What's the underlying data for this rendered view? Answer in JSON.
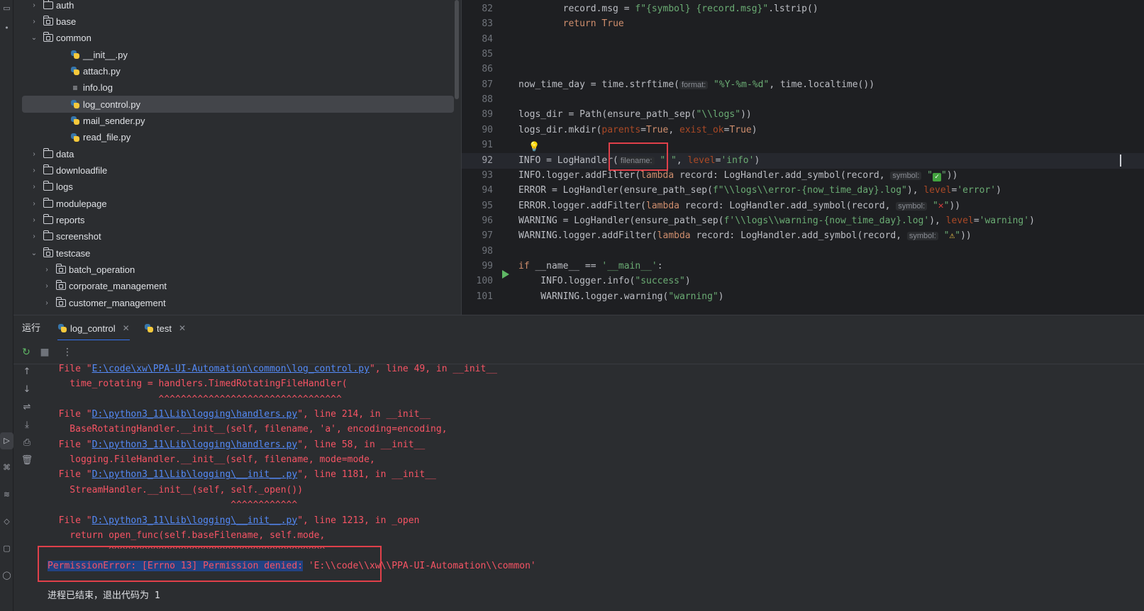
{
  "project_tree": {
    "items": [
      {
        "label": "auth",
        "type": "folder",
        "expanded": false
      },
      {
        "label": "base",
        "type": "package",
        "expanded": false
      },
      {
        "label": "common",
        "type": "package",
        "expanded": true
      },
      {
        "label": "__init__.py",
        "type": "python"
      },
      {
        "label": "attach.py",
        "type": "python"
      },
      {
        "label": "info.log",
        "type": "log"
      },
      {
        "label": "log_control.py",
        "type": "python",
        "selected": true
      },
      {
        "label": "mail_sender.py",
        "type": "python"
      },
      {
        "label": "read_file.py",
        "type": "python"
      },
      {
        "label": "data",
        "type": "folder",
        "expanded": false
      },
      {
        "label": "downloadfile",
        "type": "folder",
        "expanded": false
      },
      {
        "label": "logs",
        "type": "folder",
        "expanded": false
      },
      {
        "label": "modulepage",
        "type": "folder",
        "expanded": false
      },
      {
        "label": "reports",
        "type": "folder",
        "expanded": false
      },
      {
        "label": "screenshot",
        "type": "folder",
        "expanded": false
      },
      {
        "label": "testcase",
        "type": "package",
        "expanded": true
      },
      {
        "label": "batch_operation",
        "type": "package",
        "expanded": false
      },
      {
        "label": "corporate_management",
        "type": "package",
        "expanded": false
      },
      {
        "label": "customer_management",
        "type": "package",
        "expanded": false
      }
    ]
  },
  "editor": {
    "current_line": "92",
    "lines": [
      {
        "n": "82",
        "t": "        record.msg = f\"{symbol} {record.msg}\".lstrip()"
      },
      {
        "n": "83",
        "t": "        return True"
      },
      {
        "n": "84",
        "t": ""
      },
      {
        "n": "85",
        "t": ""
      },
      {
        "n": "86",
        "t": ""
      },
      {
        "n": "87",
        "a": "now_time_day = time.strftime(",
        "hint": "format:",
        "b": "\"%Y-%m-%d\", time.localtime())"
      },
      {
        "n": "88",
        "t": ""
      },
      {
        "n": "89",
        "t": "logs_dir = Path(ensure_path_sep(\"\\\\logs\"))"
      },
      {
        "n": "90",
        "t": "logs_dir.mkdir(parents=True, exist_ok=True)"
      },
      {
        "n": "91",
        "t": ""
      },
      {
        "n": "92",
        "a": "INFO = LogHandler(",
        "hint": "filename:",
        "b": "\" \", level='info')"
      },
      {
        "n": "93",
        "a": "INFO.logger.addFilter(lambda record: LogHandler.add_symbol(record, ",
        "hint": "symbol:",
        "b": "\"✅\"))"
      },
      {
        "n": "94",
        "t": "ERROR = LogHandler(ensure_path_sep(f\"\\\\logs\\\\error-{now_time_day}.log\"), level='error')"
      },
      {
        "n": "95",
        "a": "ERROR.logger.addFilter(lambda record: LogHandler.add_symbol(record, ",
        "hint": "symbol:",
        "b": "\"❌\"))"
      },
      {
        "n": "96",
        "t": "WARNING = LogHandler(ensure_path_sep(f'\\\\logs\\\\warning-{now_time_day}.log'), level='warning')"
      },
      {
        "n": "97",
        "a": "WARNING.logger.addFilter(lambda record: LogHandler.add_symbol(record, ",
        "hint": "symbol:",
        "b": "\"⚠\"))"
      },
      {
        "n": "98",
        "t": ""
      },
      {
        "n": "99",
        "t": "if __name__ == '__main__':"
      },
      {
        "n": "100",
        "t": "    INFO.logger.info(\"success\")"
      },
      {
        "n": "101",
        "t": "    WARNING.logger.warning(\"warning\")"
      }
    ]
  },
  "run_panel": {
    "title": "运行",
    "tabs": [
      {
        "label": "log_control",
        "active": true
      },
      {
        "label": "test",
        "active": false
      }
    ],
    "console": [
      {
        "pre": "  File \"",
        "link": "E:\\code\\xw\\PPA-UI-Automation\\common\\log_control.py",
        "post": "\", line 49, in __init__"
      },
      {
        "text": "    time_rotating = handlers.TimedRotatingFileHandler("
      },
      {
        "text": "                    ^^^^^^^^^^^^^^^^^^^^^^^^^^^^^^^^^"
      },
      {
        "pre": "  File \"",
        "link": "D:\\python3_11\\Lib\\logging\\handlers.py",
        "post": "\", line 214, in __init__"
      },
      {
        "text": "    BaseRotatingHandler.__init__(self, filename, 'a', encoding=encoding,"
      },
      {
        "pre": "  File \"",
        "link": "D:\\python3_11\\Lib\\logging\\handlers.py",
        "post": "\", line 58, in __init__"
      },
      {
        "text": "    logging.FileHandler.__init__(self, filename, mode=mode,"
      },
      {
        "pre": "  File \"",
        "link": "D:\\python3_11\\Lib\\logging\\__init__.py",
        "post": "\", line 1181, in __init__"
      },
      {
        "text": "    StreamHandler.__init__(self, self._open())"
      },
      {
        "text": "                                 ^^^^^^^^^^^^"
      },
      {
        "pre": "  File \"",
        "link": "D:\\python3_11\\Lib\\logging\\__init__.py",
        "post": "\", line 1213, in _open"
      },
      {
        "text": "    return open_func(self.baseFilename, self.mode,"
      },
      {
        "text": "           ^^^^^^^^^^^^^^^^^^^^^^^^^^^^^^^^^^^^^^^"
      },
      {
        "sel": "PermissionError: [Errno 13] Permission denied:",
        "post": " 'E:\\\\code\\\\xw\\\\PPA-UI-Automation\\\\common'"
      },
      {
        "text": "",
        "exit": true
      },
      {
        "text": "进程已结束，退出代码为 1",
        "exit": true
      }
    ]
  }
}
